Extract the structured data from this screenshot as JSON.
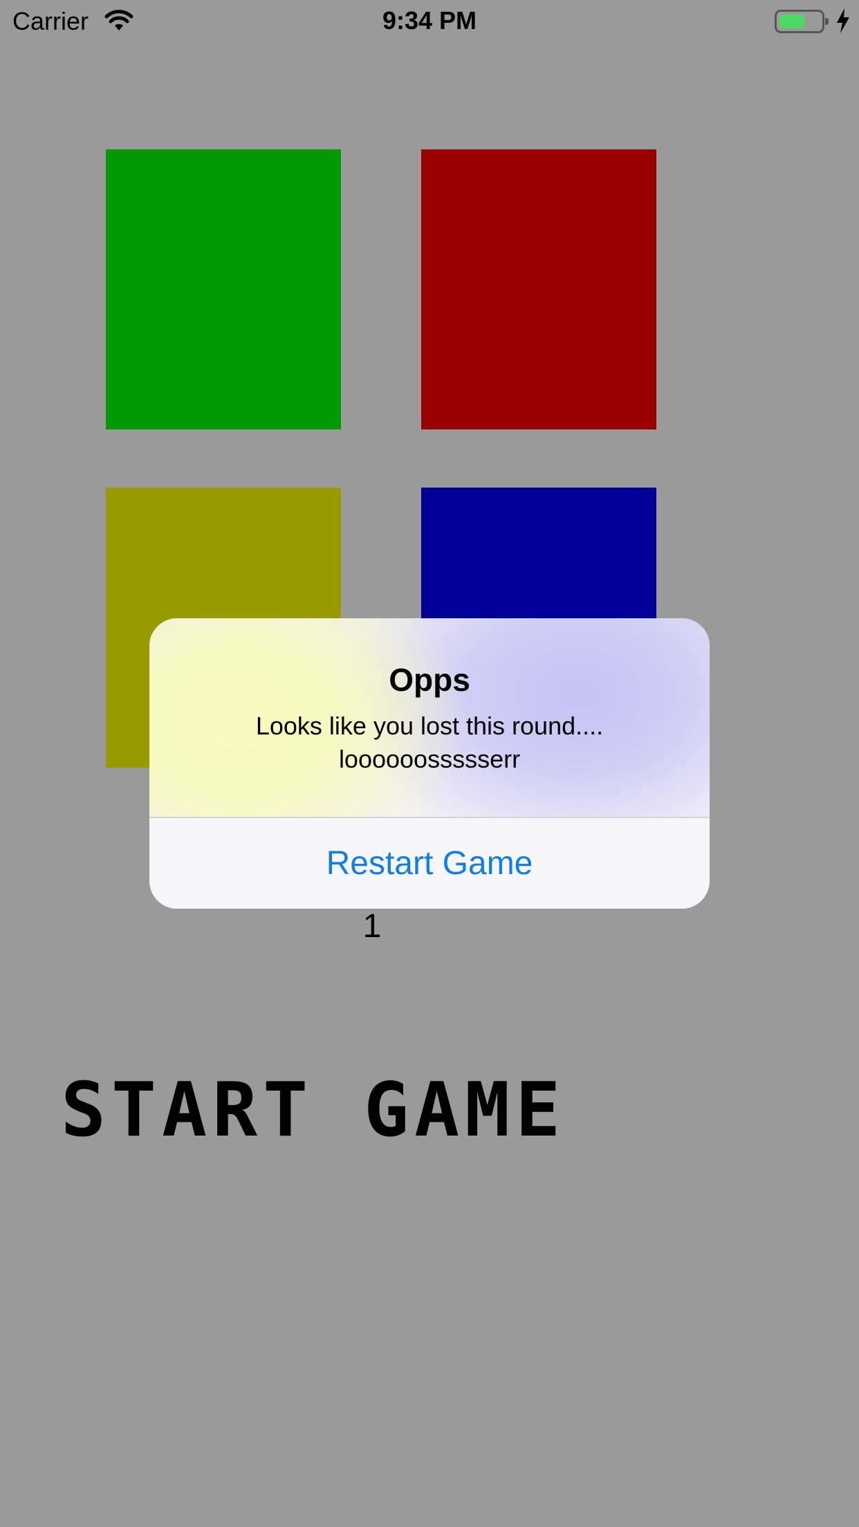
{
  "status_bar": {
    "carrier": "Carrier",
    "time": "9:34 PM",
    "wifi_icon": "wifi-icon",
    "battery_icon": "battery-icon",
    "charging_icon": "charging-bolt-icon",
    "battery_color": "#4cd964"
  },
  "game": {
    "pads": [
      {
        "name": "green",
        "color": "#009900"
      },
      {
        "name": "red",
        "color": "#990000"
      },
      {
        "name": "yellow",
        "color": "#999900"
      },
      {
        "name": "blue",
        "color": "#000099"
      }
    ],
    "round": "1",
    "start_label": "START GAME",
    "background_color": "#9a9a9a"
  },
  "alert": {
    "title": "Opps",
    "message": "Looks like you lost this round.... loooooossssserr",
    "button_label": "Restart Game",
    "button_color": "#117ee5"
  }
}
